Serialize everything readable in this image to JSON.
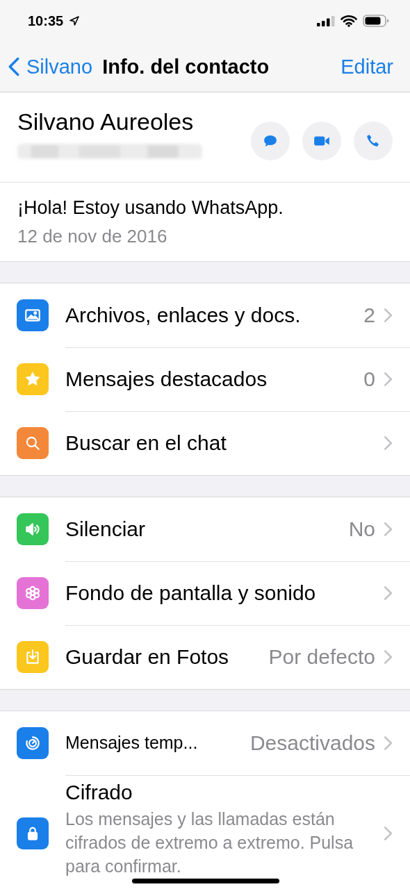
{
  "status_bar": {
    "time": "10:35"
  },
  "nav": {
    "back": "Silvano",
    "title": "Info. del contacto",
    "action": "Editar"
  },
  "contact": {
    "name": "Silvano Aureoles",
    "about": "¡Hola! Estoy usando WhatsApp.",
    "about_date": "12 de nov de 2016"
  },
  "groups": [
    {
      "rows": [
        {
          "kind": "row",
          "label": "Archivos, enlaces y docs.",
          "value": "2",
          "color": "#1a7fe8"
        },
        {
          "kind": "row",
          "label": "Mensajes destacados",
          "value": "0",
          "color": "#fbc71e"
        },
        {
          "kind": "row",
          "label": "Buscar en el chat",
          "color": "#f4883a"
        }
      ]
    },
    {
      "rows": [
        {
          "kind": "row",
          "label": "Silenciar",
          "value": "No",
          "color": "#35c659"
        },
        {
          "kind": "row",
          "label": "Fondo de pantalla y sonido",
          "color": "#e573d6"
        },
        {
          "kind": "row",
          "label": "Guardar en Fotos",
          "value": "Por defecto",
          "color": "#fbc71e"
        }
      ]
    },
    {
      "rows": [
        {
          "kind": "compact",
          "label": "Mensajes temp...",
          "value": "Desactivados",
          "color": "#1a7fe8"
        },
        {
          "kind": "description",
          "label": "Cifrado",
          "description": "Los mensajes y las llamadas están cifrados de extremo a extremo. Pulsa para confirmar.",
          "color": "#1a7fe8"
        }
      ]
    }
  ]
}
